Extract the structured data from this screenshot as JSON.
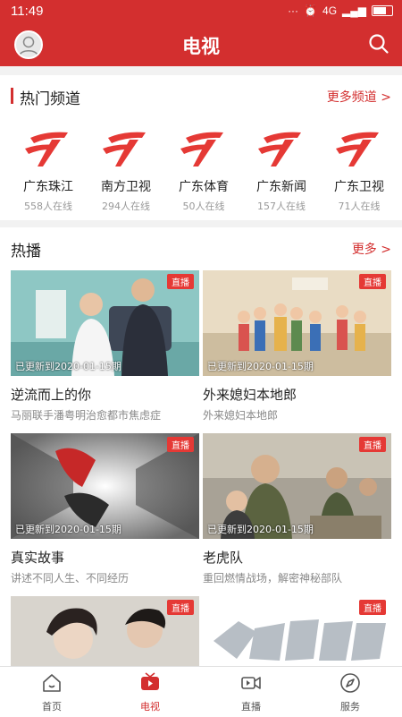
{
  "status_bar": {
    "time": "11:49",
    "network": "4G"
  },
  "header": {
    "title": "电视"
  },
  "hot_channels": {
    "title": "热门频道",
    "more": "更多频道 >",
    "items": [
      {
        "name": "广东珠江",
        "online": "558人在线"
      },
      {
        "name": "南方卫视",
        "online": "294人在线"
      },
      {
        "name": "广东体育",
        "online": "50人在线"
      },
      {
        "name": "广东新闻",
        "online": "157人在线"
      },
      {
        "name": "广东卫视",
        "online": "71人在线"
      }
    ]
  },
  "hot_shows": {
    "title": "热播",
    "more": "更多 >",
    "items": [
      {
        "title": "逆流而上的你",
        "subtitle": "马丽联手潘粤明治愈都市焦虑症",
        "badge": "直播",
        "updated": "已更新到2020-01-15期"
      },
      {
        "title": "外来媳妇本地郎",
        "subtitle": "外来媳妇本地郎",
        "badge": "直播",
        "updated": "已更新到2020-01-15期"
      },
      {
        "title": "真实故事",
        "subtitle": "讲述不同人生、不同经历",
        "badge": "直播",
        "updated": "已更新到2020-01-15期"
      },
      {
        "title": "老虎队",
        "subtitle": "重回燃情战场，解密神秘部队",
        "badge": "直播",
        "updated": "已更新到2020-01-15期"
      },
      {
        "badge": "直播"
      },
      {
        "badge": "直播"
      }
    ]
  },
  "tabbar": {
    "items": [
      {
        "label": "首页"
      },
      {
        "label": "电视"
      },
      {
        "label": "直播"
      },
      {
        "label": "服务"
      }
    ],
    "active": "电视"
  },
  "colors": {
    "brand": "#d32f2f",
    "live_badge": "#e53935"
  }
}
